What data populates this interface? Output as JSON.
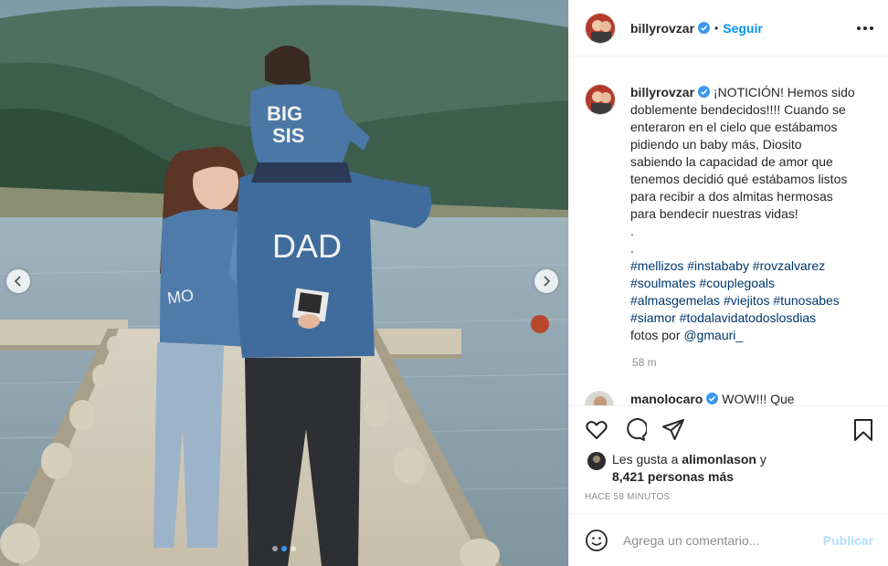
{
  "post": {
    "username": "billyrovzar",
    "follow_label": "Seguir",
    "bullet": "•",
    "photo_texts": {
      "kid_jacket": "BIG SIS",
      "dad_jacket": "DAD",
      "mom_jacket": "MO"
    },
    "carousel": {
      "total": 3,
      "active": 2
    },
    "caption": {
      "username": "billyrovzar",
      "lines": [
        "¡NOTICIÓN! Hemos sido",
        "doblemente bendecidos!!!! Cuando se",
        "enteraron en el cielo que estábamos",
        "pidiendo un baby más, Diosito",
        "sabiendo la capacidad de amor que",
        "tenemos decidió qué estábamos listos",
        "para recibir a dos almitas hermosas",
        "para bendecir nuestras vidas!",
        ".",
        "."
      ],
      "hashtag_lines": [
        "#mellizos #instababy #rovzalvarez",
        "#soulmates #couplegoals",
        "#almasgemelas #viejitos #tunosabes",
        "#siamor #todalavidatodoslosdias"
      ],
      "credit_prefix": "fotos por ",
      "credit_handle": "@gmauri_",
      "time": "58 m"
    },
    "next_comment": {
      "username": "manolocaro",
      "text": "WOW!!! Que"
    },
    "likes": {
      "prefix": "Les gusta a ",
      "user": "alimonlason",
      "connector": " y",
      "count": "8,421 personas más"
    },
    "posted_ago": "HACE 58 MINUTOS",
    "comment_input": {
      "placeholder": "Agrega un comentario...",
      "publish_label": "Publicar"
    },
    "icons": [
      "heart-icon",
      "comment-icon",
      "share-icon",
      "bookmark-icon",
      "emoji-icon",
      "verified-icon",
      "more-icon"
    ],
    "colors": {
      "link": "#00376b",
      "follow": "#0095f6",
      "publish_disabled": "#b2dffc",
      "verified": "#3897f0"
    }
  }
}
